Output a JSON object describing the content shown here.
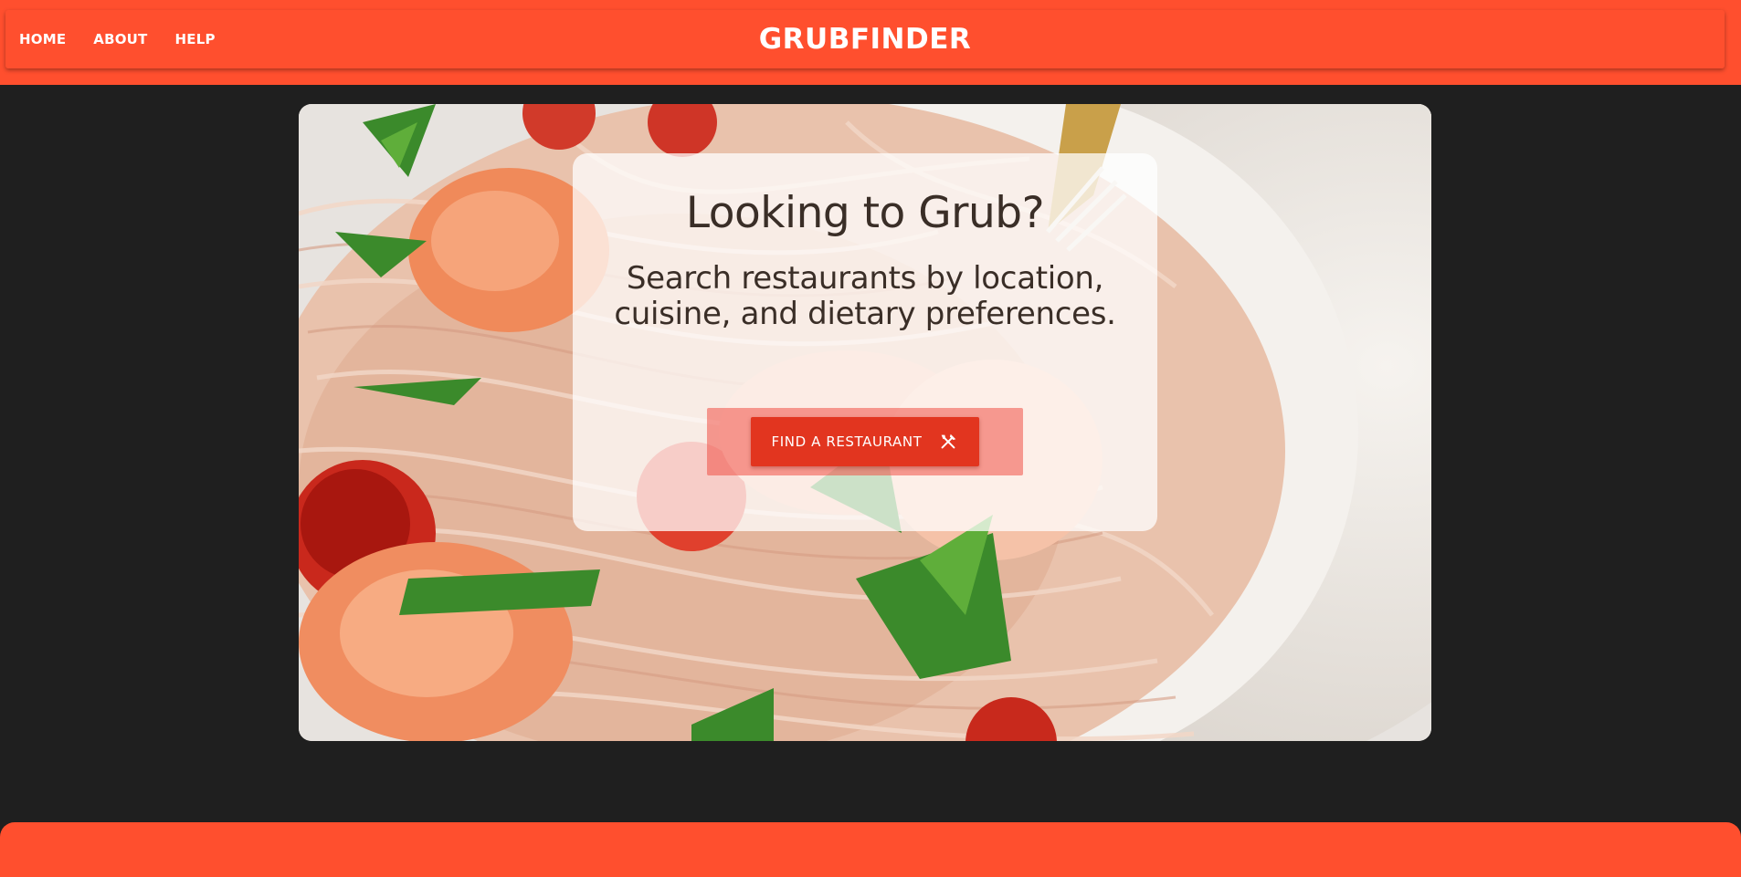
{
  "header": {
    "nav_items": [
      {
        "label": "HOME"
      },
      {
        "label": "ABOUT"
      },
      {
        "label": "HELP"
      }
    ],
    "brand": "GRUBFINDER"
  },
  "hero": {
    "title": "Looking to Grub?",
    "subtitle": "Search restaurants by location, cuisine, and dietary preferences.",
    "cta_label": "FIND A RESTAURANT",
    "cta_icon": "fork-knife-icon",
    "background_image": "pasta-shrimp-plate-photo"
  },
  "colors": {
    "brand": "#ff4f2e",
    "page_background": "#1f1f1f",
    "cta": "#e2351f",
    "text_dark": "#3a2e27"
  }
}
